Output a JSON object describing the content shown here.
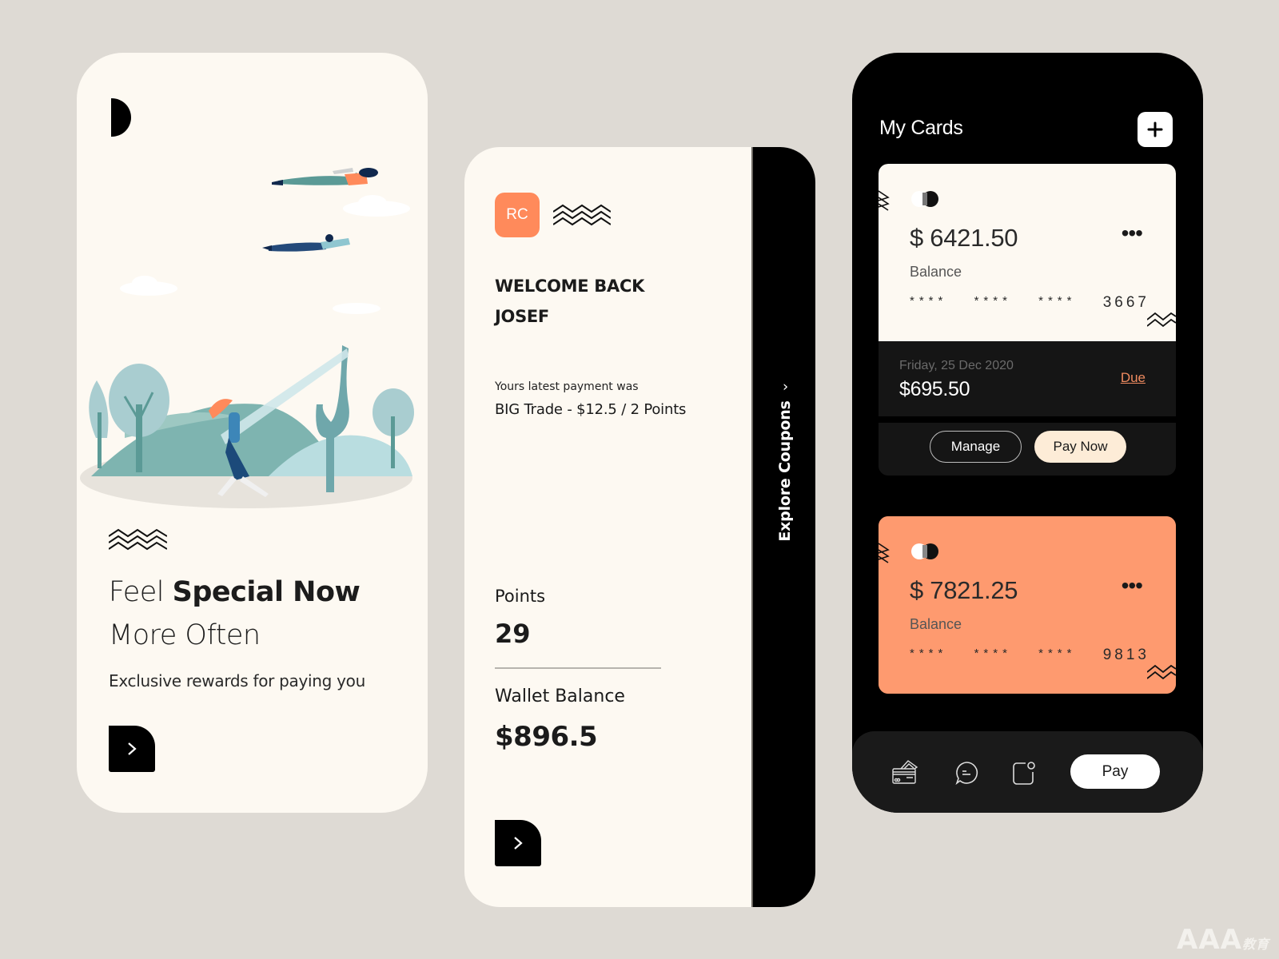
{
  "screen1": {
    "title_regular": "Feel ",
    "title_bold": "Special Now",
    "title_line2": "More Often",
    "subtitle": "Exclusive rewards for paying you"
  },
  "screen2": {
    "avatar_initials": "RC",
    "welcome_line1": "WELCOME BACK",
    "welcome_line2": "JOSEF",
    "latest_payment_label": "Yours latest payment was",
    "latest_payment_value": "BIG Trade - $12.5 / 2 Points",
    "points_label": "Points",
    "points_value": "29",
    "wallet_label": "Wallet Balance",
    "wallet_value": "$896.5",
    "side_tab_label": "Explore Coupons"
  },
  "screen3": {
    "title": "My Cards",
    "cards": [
      {
        "balance": "$ 6421.50",
        "balance_label": "Balance",
        "masked_groups": [
          "****",
          "****",
          "****"
        ],
        "last4": "3667",
        "color": "#fdf9f2",
        "due_date": "Friday, 25 Dec 2020",
        "due_amount": "$695.50",
        "due_label": "Due",
        "manage_label": "Manage",
        "paynow_label": "Pay Now"
      },
      {
        "balance": "$ 7821.25",
        "balance_label": "Balance",
        "masked_groups": [
          "****",
          "****",
          "****"
        ],
        "last4": "9813",
        "color": "#fe9a6f"
      }
    ],
    "nav": {
      "icons": [
        "cards-icon",
        "chat-icon",
        "notification-icon"
      ],
      "pay_label": "Pay"
    }
  },
  "colors": {
    "background": "#dedad4",
    "cream": "#fdf9f2",
    "accent_orange": "#fe9a6f",
    "avatar_orange": "#ff8a5b",
    "due_orange": "#ee8a5f",
    "black": "#000000"
  },
  "watermark": {
    "text": "AAA",
    "suffix": "教育"
  }
}
